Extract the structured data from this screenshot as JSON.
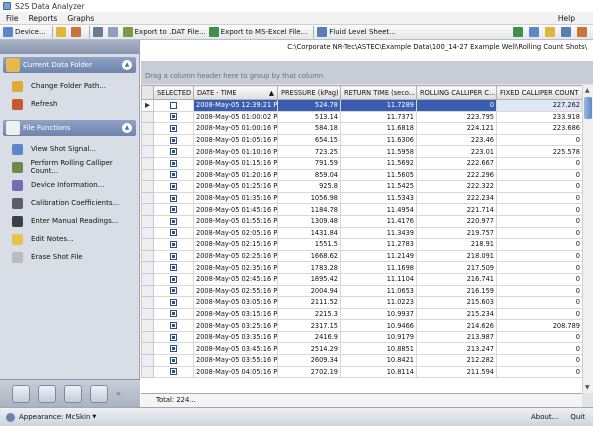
{
  "app": {
    "title": "S2S Data Analyzer"
  },
  "menu": {
    "file": "File",
    "reports": "Reports",
    "graphs": "Graphs",
    "help": "Help"
  },
  "toolbar": {
    "device": "Device...",
    "export_dat": "Export to .DAT File...",
    "export_excel": "Export to MS-Excel File...",
    "fluid_level": "Fluid Level Sheet..."
  },
  "path": "C:\\Corporate NR-Tec\\ASTEC\\Example Data\\100_14-27 Example Well\\Rolling Count Shots\\",
  "group_hint": "Drag a column header here to group by that column",
  "sidebar": {
    "current_folder_title": "Current Data Folder",
    "folder_items": [
      {
        "label": "Change Folder Path..."
      },
      {
        "label": "Refresh"
      }
    ],
    "file_functions_title": "File Functions",
    "function_items": [
      {
        "label": "View Shot Signal..."
      },
      {
        "label": "Perform Rolling Calliper Count..."
      },
      {
        "label": "Device Information..."
      },
      {
        "label": "Calibration Coefficients..."
      },
      {
        "label": "Enter Manual Readings..."
      },
      {
        "label": "Edit Notes..."
      },
      {
        "label": "Erase Shot File"
      }
    ]
  },
  "columns": [
    "SELECTED",
    "DATE - TIME",
    "PRESSURE (kPag)",
    "RETURN TIME (seco...",
    "ROLLING CALLIPER C...",
    "FIXED CALLIPER COUNT"
  ],
  "rows": [
    {
      "sel": false,
      "date": "2008-May-05 12:39:21 PM",
      "pressure": "524.78",
      "ret": "11.7289",
      "roll": "0",
      "fixed": "227.262"
    },
    {
      "sel": true,
      "date": "2008-May-05 01:00:02 PM",
      "pressure": "513.14",
      "ret": "11.7371",
      "roll": "223.795",
      "fixed": "233.918"
    },
    {
      "sel": true,
      "date": "2008-May-05 01:00:16 PM",
      "pressure": "584.18",
      "ret": "11.6818",
      "roll": "224.121",
      "fixed": "223.686"
    },
    {
      "sel": true,
      "date": "2008-May-05 01:05:16 PM",
      "pressure": "654.15",
      "ret": "11.6306",
      "roll": "223.46",
      "fixed": "0"
    },
    {
      "sel": true,
      "date": "2008-May-05 01:10:16 PM",
      "pressure": "723.25",
      "ret": "11.5958",
      "roll": "223.01",
      "fixed": "225.578"
    },
    {
      "sel": true,
      "date": "2008-May-05 01:15:16 PM",
      "pressure": "791.59",
      "ret": "11.5692",
      "roll": "222.667",
      "fixed": "0"
    },
    {
      "sel": true,
      "date": "2008-May-05 01:20:16 PM",
      "pressure": "859.04",
      "ret": "11.5605",
      "roll": "222.296",
      "fixed": "0"
    },
    {
      "sel": true,
      "date": "2008-May-05 01:25:16 PM",
      "pressure": "925.8",
      "ret": "11.5425",
      "roll": "222.322",
      "fixed": "0"
    },
    {
      "sel": true,
      "date": "2008-May-05 01:35:16 PM",
      "pressure": "1056.98",
      "ret": "11.5343",
      "roll": "222.234",
      "fixed": "0"
    },
    {
      "sel": true,
      "date": "2008-May-05 01:45:16 PM",
      "pressure": "1184.78",
      "ret": "11.4954",
      "roll": "221.714",
      "fixed": "0"
    },
    {
      "sel": true,
      "date": "2008-May-05 01:55:16 PM",
      "pressure": "1309.48",
      "ret": "11.4176",
      "roll": "220.977",
      "fixed": "0"
    },
    {
      "sel": true,
      "date": "2008-May-05 02:05:16 PM",
      "pressure": "1431.84",
      "ret": "11.3439",
      "roll": "219.757",
      "fixed": "0"
    },
    {
      "sel": true,
      "date": "2008-May-05 02:15:16 PM",
      "pressure": "1551.5",
      "ret": "11.2783",
      "roll": "218.91",
      "fixed": "0"
    },
    {
      "sel": true,
      "date": "2008-May-05 02:25:16 PM",
      "pressure": "1668.62",
      "ret": "11.2149",
      "roll": "218.091",
      "fixed": "0"
    },
    {
      "sel": true,
      "date": "2008-May-05 02:35:16 PM",
      "pressure": "1783.28",
      "ret": "11.1698",
      "roll": "217.509",
      "fixed": "0"
    },
    {
      "sel": true,
      "date": "2008-May-05 02:45:16 PM",
      "pressure": "1895.42",
      "ret": "11.1104",
      "roll": "216.741",
      "fixed": "0"
    },
    {
      "sel": true,
      "date": "2008-May-05 02:55:16 PM",
      "pressure": "2004.94",
      "ret": "11.0653",
      "roll": "216.159",
      "fixed": "0"
    },
    {
      "sel": true,
      "date": "2008-May-05 03:05:16 PM",
      "pressure": "2111.52",
      "ret": "11.0223",
      "roll": "215.603",
      "fixed": "0"
    },
    {
      "sel": true,
      "date": "2008-May-05 03:15:16 PM",
      "pressure": "2215.3",
      "ret": "10.9937",
      "roll": "215.234",
      "fixed": "0"
    },
    {
      "sel": true,
      "date": "2008-May-05 03:25:16 PM",
      "pressure": "2317.15",
      "ret": "10.9466",
      "roll": "214.626",
      "fixed": "208.789"
    },
    {
      "sel": true,
      "date": "2008-May-05 03:35:16 PM",
      "pressure": "2416.9",
      "ret": "10.9179",
      "roll": "213.987",
      "fixed": "0"
    },
    {
      "sel": true,
      "date": "2008-May-05 03:45:16 PM",
      "pressure": "2514.29",
      "ret": "10.8851",
      "roll": "213.247",
      "fixed": "0"
    },
    {
      "sel": true,
      "date": "2008-May-05 03:55:16 PM",
      "pressure": "2609.34",
      "ret": "10.8421",
      "roll": "212.282",
      "fixed": "0"
    },
    {
      "sel": true,
      "date": "2008-May-05 04:05:16 PM",
      "pressure": "2702.19",
      "ret": "10.8114",
      "roll": "211.594",
      "fixed": "0"
    }
  ],
  "footer": {
    "total": "Total: 224..."
  },
  "status": {
    "appearance": "Appearance: McSkin",
    "about": "About...",
    "quit": "Quit"
  },
  "colors": {
    "header_blue": "#6d84ad",
    "selection": "#3b5db0",
    "sidebar_bg": "#d9dde6"
  }
}
